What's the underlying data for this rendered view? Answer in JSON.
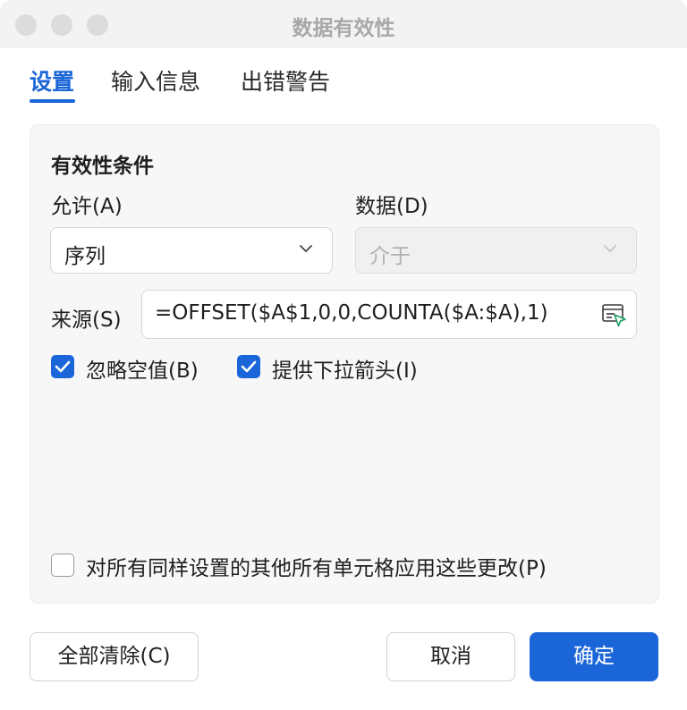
{
  "window": {
    "title": "数据有效性"
  },
  "tabs": [
    {
      "label": "设置",
      "active": true
    },
    {
      "label": "输入信息",
      "active": false
    },
    {
      "label": "出错警告",
      "active": false
    }
  ],
  "criteria": {
    "section_title": "有效性条件",
    "allow_label": "允许(A)",
    "allow_value": "序列",
    "data_label": "数据(D)",
    "data_value": "介于",
    "source_label": "来源(S)",
    "source_value": "=OFFSET($A$1,0,0,COUNTA($A:$A),1)"
  },
  "options": {
    "ignore_blank": {
      "label": "忽略空值(B)",
      "checked": true
    },
    "in_cell_dropdown": {
      "label": "提供下拉箭头(I)",
      "checked": true
    },
    "apply_all": {
      "label": "对所有同样设置的其他所有单元格应用这些更改(P)",
      "checked": false
    }
  },
  "buttons": {
    "clear_all": "全部清除(C)",
    "cancel": "取消",
    "ok": "确定"
  },
  "colors": {
    "accent": "#1a66d8",
    "picker_icon": "#1e9e62"
  }
}
